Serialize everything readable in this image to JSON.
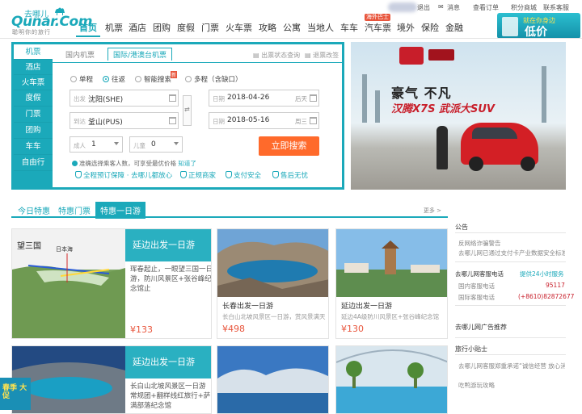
{
  "colors": {
    "accent": "#1ba9ba",
    "orange": "#ff6a2b",
    "price": "#e8553c"
  },
  "topbar": {
    "logout": "退出",
    "messages": "消息",
    "orders": "查看订单",
    "points_mall": "积分商城",
    "contact": "联系客服"
  },
  "logo": {
    "cn": "去哪儿",
    "en": "Qunar.Com",
    "slogan": "聪明你的旅行"
  },
  "nav": {
    "items": [
      "首页",
      "机票",
      "酒店",
      "团购",
      "度假",
      "门票",
      "火车票",
      "攻略",
      "公寓",
      "当地人",
      "车车",
      "汽车票",
      "境外",
      "保险",
      "金融"
    ],
    "badge": "海外巴士"
  },
  "top_ad": {
    "line1": "就在你身边",
    "line2": "低价"
  },
  "search": {
    "side_tabs": [
      "机票",
      "酒店",
      "火车票",
      "度假",
      "门票",
      "团购",
      "车车",
      "自由行"
    ],
    "sub_tabs": [
      "国内机票",
      "国际/港澳台机票"
    ],
    "right_links": [
      "出票状态查询",
      "退票改签"
    ],
    "trip_types": [
      "单程",
      "往返",
      "智能搜索",
      "多程（含缺口）"
    ],
    "new_tag": "新",
    "from_label": "出发",
    "from_value": "沈阳(SHE)",
    "to_label": "到达",
    "to_value": "釜山(PUS)",
    "swap_icon": "⇄",
    "depart_label": "日期",
    "depart_value": "2018-04-26",
    "depart_week": "后天",
    "return_label": "日期",
    "return_value": "2018-05-16",
    "return_week": "周三",
    "adults_label": "成人",
    "adults_value": "1",
    "children_label": "儿童",
    "children_value": "0",
    "search_button": "立即搜索",
    "tip": "准确选择乘客人数，可享受最优价格",
    "tip_link": "知道了",
    "guarantees": [
      "全程预订保障 · 去哪儿都放心",
      "正规商家",
      "支付安全",
      "售后无忧"
    ]
  },
  "banner": {
    "headline": "豪气 不凡",
    "sub": "汉腾X7S 武派大SUV"
  },
  "deal_tabs": {
    "tabs": [
      "今日特惠",
      "特惠门票",
      "特惠一日游"
    ],
    "more": "更多 >"
  },
  "cards": [
    {
      "panel": "延边出发一日游",
      "desc": "珲春起止，一眼望三国一日游，防川风景区+张谷峰纪念馆止",
      "price": "¥133",
      "map_label": "日本海"
    },
    {
      "title": "长春出发一日游",
      "desc": "长白山北坡风景区一日游，赏风景满天",
      "price": "¥498"
    },
    {
      "title": "延边出发一日游",
      "desc": "延边4A级防川风景区+张谷峰纪念馆",
      "price": "¥130"
    },
    {
      "panel": "延边出发一日游",
      "desc": "长白山北坡风景区一日游 常规团+翻样线红旅行+萨满部落纪念馆"
    },
    {},
    {}
  ],
  "right": {
    "notice_title": "公告",
    "notice_lines": [
      "反网络诈骗警告",
      "去哪儿网已通过支付卡产业数据安全标准"
    ],
    "service_title": "去哪儿网客服电话",
    "service_badge": "提供24小时服务",
    "domestic_label": "国内客服电话",
    "domestic_phone": "95117",
    "intl_label": "国际客服电话",
    "intl_phone": "(+8610)82872677",
    "ad_title": "去哪儿网广告推荐",
    "tips_title": "旅行小贴士",
    "tips_lines": [
      "去哪儿网客服郑重承诺“诚信经营 放心消费”",
      "吃鸭游玩攻略"
    ]
  },
  "promo": {
    "text": "春季 大促"
  }
}
